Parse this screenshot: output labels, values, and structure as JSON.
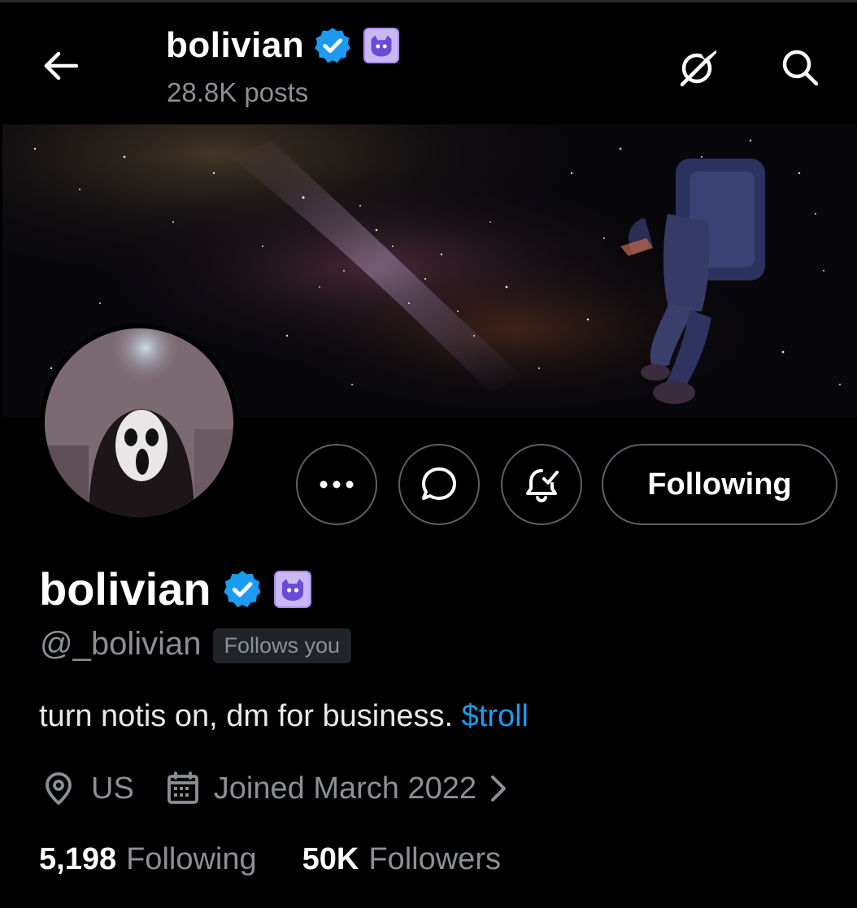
{
  "header": {
    "name": "bolivian",
    "posts_count": "28.8K posts"
  },
  "profile": {
    "name": "bolivian",
    "handle": "@_bolivian",
    "follows_you_badge": "Follows you",
    "bio_text": "turn notis on, dm for business. ",
    "bio_link": "$troll",
    "location": "US",
    "joined": "Joined March 2022",
    "following_count": "5,198",
    "following_label": "Following",
    "followers_count": "50K",
    "followers_label": "Followers"
  },
  "actions": {
    "more_label": "•••",
    "following_button": "Following"
  },
  "icons": {
    "back": "arrow-left-icon",
    "grok": "grok-icon",
    "search": "search-icon",
    "verified": "verified-badge-icon",
    "affiliate": "affiliate-badge-icon",
    "more": "more-dots-icon",
    "message": "message-bubble-icon",
    "notify": "bell-check-icon",
    "location": "location-pin-icon",
    "calendar": "calendar-icon",
    "chevron": "chevron-right-icon"
  },
  "colors": {
    "background": "#000000",
    "verified": "#1d9bf0",
    "link": "#1d9bf0",
    "affiliate_badge": "#c9b8f5",
    "secondary_text": "#8b9096",
    "border": "#5b6166"
  }
}
